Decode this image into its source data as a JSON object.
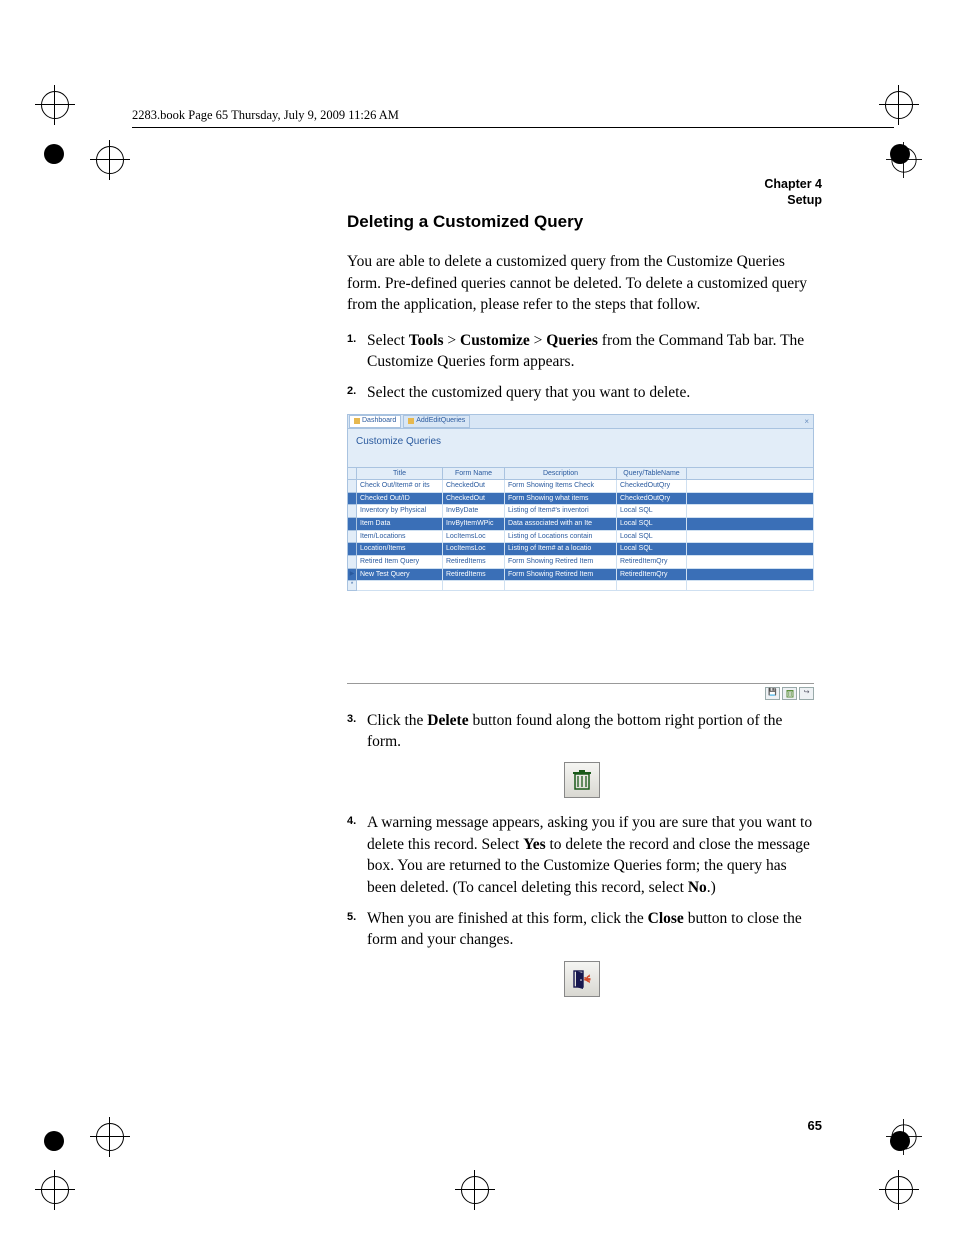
{
  "headline": "2283.book  Page 65  Thursday, July 9, 2009  11:26 AM",
  "chapter_line1": "Chapter 4",
  "chapter_line2": "Setup",
  "section_title": "Deleting a Customized Query",
  "intro": "You are able to delete a customized query from the Customize Queries form. Pre-defined queries cannot be deleted. To delete a customized query from the application, please refer to the steps that follow.",
  "step1_a": "Select ",
  "step1_tools": "Tools",
  "step1_gt1": " > ",
  "step1_customize": "Customize",
  "step1_gt2": " > ",
  "step1_queries": "Queries",
  "step1_b": " from the Command Tab bar. The Customize Queries form appears.",
  "step2": "Select the customized query that you want to delete.",
  "step3_a": "Click the ",
  "step3_delete": "Delete",
  "step3_b": " button found along the bottom right portion of the form.",
  "step4_a": "A warning message appears, asking you if you are sure that you want to delete this record. Select ",
  "step4_yes": "Yes",
  "step4_b": " to delete the record and close the message box. You are returned to the Customize Queries form; the query has been deleted. (To cancel deleting this record, select ",
  "step4_no": "No",
  "step4_c": ".)",
  "step5_a": "When you are finished at this form, click the ",
  "step5_close": "Close",
  "step5_b": " button to close the form and your changes.",
  "page_number": "65",
  "shot": {
    "tab1": "Dashboard",
    "tab2": "AddEditQueries",
    "form_title": "Customize Queries",
    "col_title": "Title",
    "col_form": "Form Name",
    "col_desc": "Description",
    "col_qt": "Query/TableName",
    "rows": [
      {
        "t": "Check Out/Item# or its",
        "f": "CheckedOut",
        "d": "Form Showing Items Check",
        "q": "CheckedOutQry"
      },
      {
        "t": "Checked Out/ID",
        "f": "CheckedOut",
        "d": "Form Showing what items",
        "q": "CheckedOutQry"
      },
      {
        "t": "Inventory by Physical",
        "f": "InvByDate",
        "d": "Listing of Item#'s inventori",
        "q": "Local SQL"
      },
      {
        "t": "Item Data",
        "f": "InvByItemWPic",
        "d": "Data associated with an Ite",
        "q": "Local SQL"
      },
      {
        "t": "Item/Locations",
        "f": "LocItemsLoc",
        "d": "Listing of Locations contain",
        "q": "Local SQL"
      },
      {
        "t": "Location/Items",
        "f": "LocItemsLoc",
        "d": "Listing of Item# at a locatio",
        "q": "Local SQL"
      },
      {
        "t": "Retired Item Query",
        "f": "RetiredItems",
        "d": "Form Showing Retired Item",
        "q": "RetiredItemQry"
      },
      {
        "t": "New Test Query",
        "f": "RetiredItems",
        "d": "Form Showing Retired Item",
        "q": "RetiredItemQry"
      }
    ]
  }
}
